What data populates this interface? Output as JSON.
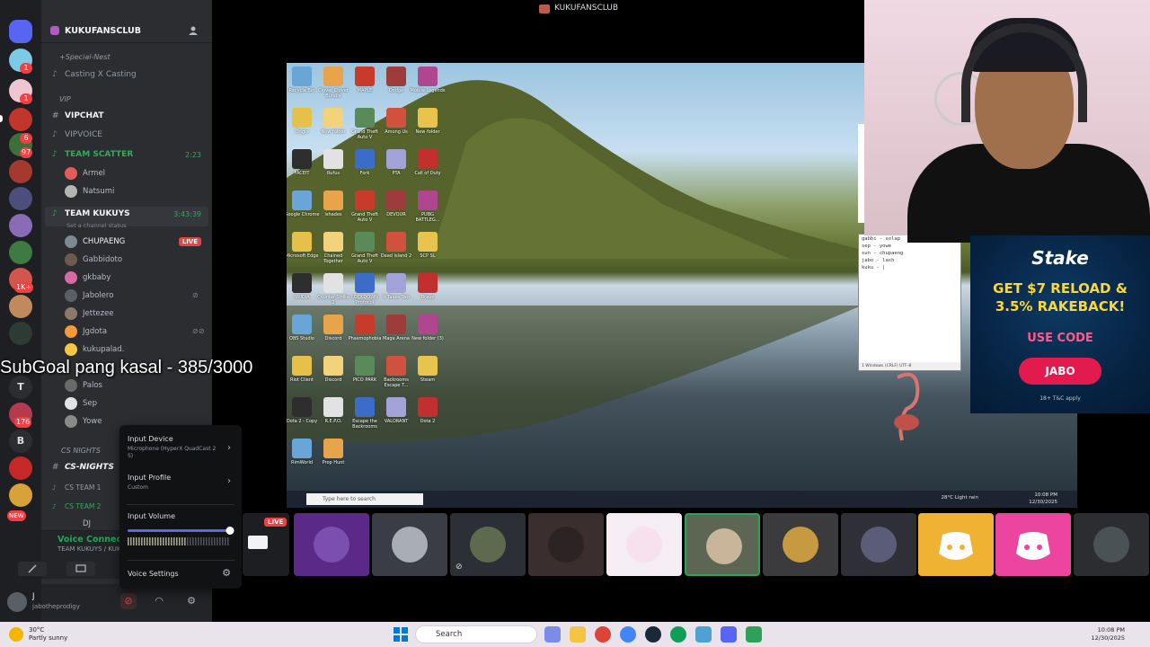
{
  "window_title": "KUKUFANSCLUB",
  "server": {
    "name": "KUKUFANSCLUB"
  },
  "rail": {
    "badges": [
      "1",
      "1",
      "6",
      "97",
      "1K+",
      "176"
    ],
    "letters": [
      "T",
      "B"
    ],
    "new_label": "NEW"
  },
  "channels": {
    "cat_special": "+Special-Nest",
    "casting": "Casting X Casting",
    "cat_vip": "VIP",
    "vipchat": "VIPCHAT",
    "vipvoice": "VIPVOICE",
    "team_scatter": "TEAM SCATTER",
    "team_scatter_time": "2:23",
    "scatter_users": [
      "Armel",
      "Natsumi"
    ],
    "team_kukuys": "TEAM KUKUYS",
    "team_kukuys_time": "3:43:39",
    "channel_status": "Set a channel status",
    "kukuys_users": [
      "CHUPAENG",
      "Gabbidoto",
      "gkbaby",
      "Jabolero",
      "Jettezee",
      "Jgdota",
      "kukupalad.",
      "Palos",
      "Sep",
      "Yowe"
    ],
    "live_label": "LIVE",
    "cat_cs": "CS NIGHTS",
    "cs_nights": "CS-NIGHTS",
    "cs_team1": "CS TEAM 1",
    "cs_team2": "CS TEAM 2",
    "dj": "DJ"
  },
  "voice": {
    "status": "Voice Connected",
    "channel": "TEAM KUKUYS / KUKUFANSCLUB"
  },
  "user": {
    "display": "J",
    "handle": "jabotheprodigy"
  },
  "popup": {
    "input_device_label": "Input Device",
    "input_device_value": "Microphone (HyperX QuadCast 2 S)",
    "input_profile_label": "Input Profile",
    "input_profile_value": "Custom",
    "input_volume_label": "Input Volume",
    "input_volume_level": 1.0,
    "voice_settings_label": "Voice Settings"
  },
  "overlay_text": "SubGoal pang kasal - 385/3000",
  "desktop_icons": [
    "Recycle Bin",
    "Clover Clover Bundle",
    "MAPLE",
    "Dodge",
    "Mobile Legends",
    "Origin",
    "New folder",
    "Grand Theft Auto V",
    "Among Us",
    "New folder",
    "FACEIT",
    "Rufus",
    "Fork",
    "PTA",
    "Call of Duty",
    "Google Chrome",
    "ishades",
    "Grand Theft Auto V",
    "DEVOUR",
    "PUBG BATTLEG...",
    "Microsoft Edge",
    "Chained Together",
    "Grand Theft Auto V",
    "Dead Island 2",
    "SCP SL",
    "NVIDIA",
    "Counter-Strike 2",
    "LOCKDOWN Protocol",
    "It Takes Two",
    "Brave",
    "OBS Studio",
    "Discord",
    "Phasmophobia",
    "Mage Arena",
    "New folder (3)",
    "Riot Client",
    "Discord",
    "PICO PARK",
    "Backrooms Escape T...",
    "Steam",
    "Dota 2 - Copy",
    "R.E.P.O.",
    "Escape the Backrooms",
    "VALORANT",
    "Dota 2",
    "RimWorld",
    "Prop Hunt"
  ],
  "inner_taskbar": {
    "search": "Type here to search",
    "weather": "28°C Light rain",
    "time": "10:08 PM",
    "date": "12/30/2025"
  },
  "notepad": {
    "lines": [
      "gabbi - solap",
      "sep - yowe",
      "sun - chupaeng",
      "jabo - lash",
      "kuku - |"
    ],
    "status": "1 Windows (CRLF)   UTF-8"
  },
  "ad": {
    "brand": "Stake",
    "headline1": "GET $7 RELOAD &",
    "headline2": "3.5% RAKEBACK!",
    "use_code": "USE CODE",
    "code": "JABO",
    "terms": "18+ T&C apply"
  },
  "strip": {
    "live_label": "LIVE"
  },
  "taskbar": {
    "weather_temp": "30°C",
    "weather_desc": "Partly sunny",
    "search": "Search",
    "time": "10:08 PM",
    "date": "12/30/2025"
  },
  "colors": {
    "sidebar": "#2b2d31",
    "rail": "#1e1f22",
    "voice_green": "#23a55a",
    "live_red": "#ed4245",
    "discord_blurple": "#5865f2"
  }
}
